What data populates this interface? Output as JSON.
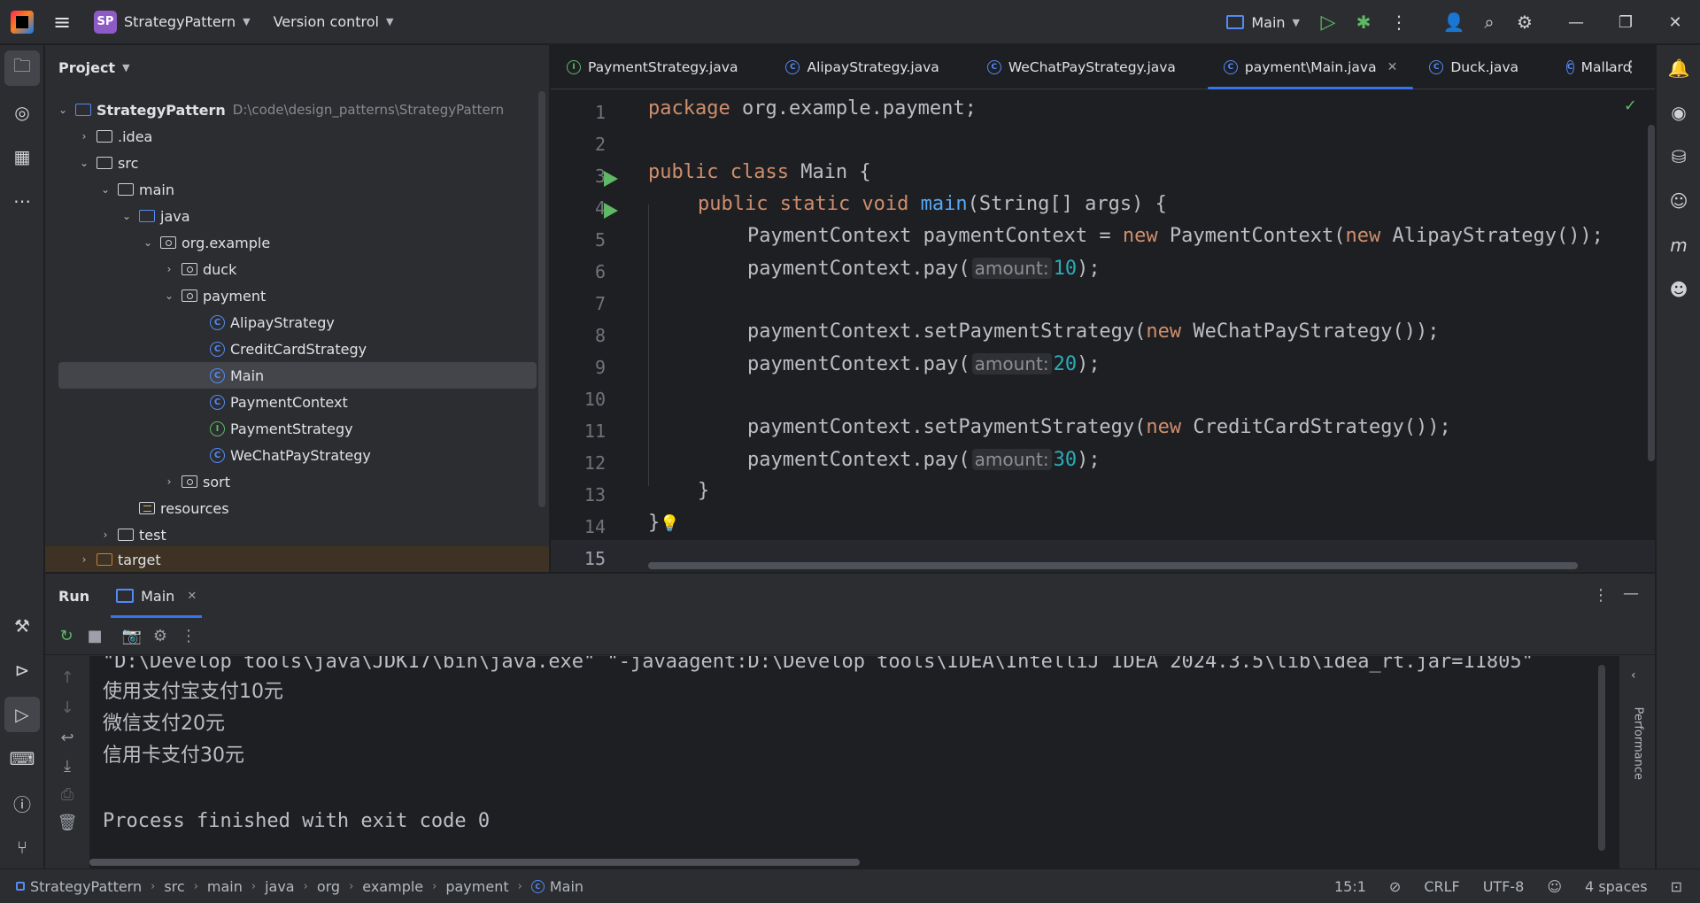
{
  "titlebar": {
    "project_badge": "SP",
    "project_name": "StrategyPattern",
    "vcs": "Version control",
    "run_config": "Main"
  },
  "project_panel": {
    "title": "Project",
    "root_name": "StrategyPattern",
    "root_path": "D:\\code\\design_patterns\\StrategyPattern",
    "items": [
      ".idea",
      "src",
      "main",
      "java",
      "org.example",
      "duck",
      "payment",
      "AlipayStrategy",
      "CreditCardStrategy",
      "Main",
      "PaymentContext",
      "PaymentStrategy",
      "WeChatPayStrategy",
      "sort",
      "resources",
      "test",
      "target"
    ]
  },
  "editor": {
    "tabs": [
      "PaymentStrategy.java",
      "AlipayStrategy.java",
      "WeChatPayStrategy.java",
      "payment\\Main.java",
      "Duck.java",
      "Mallard"
    ],
    "line_numbers": [
      "1",
      "2",
      "3",
      "4",
      "5",
      "6",
      "7",
      "8",
      "9",
      "10",
      "11",
      "12",
      "13",
      "14",
      "15"
    ],
    "code": {
      "l1_kw": "package",
      "l1_rest": " org.example.payment;",
      "l3_kw": "public class",
      "l3_rest": " Main {",
      "l4_kw": "public static void",
      "l4_fn": "main",
      "l4_rest": "(String[] args) {",
      "l5_a": "PaymentContext paymentContext = ",
      "l5_kw1": "new",
      "l5_b": " PaymentContext(",
      "l5_kw2": "new",
      "l5_c": " AlipayStrategy());",
      "pay_call": "paymentContext.pay(",
      "hint_label": "amount:",
      "v10": "10",
      "v20": "20",
      "v30": "30",
      "call_end": ");",
      "set_call": "paymentContext.setPaymentStrategy(",
      "kw_new": "new",
      "l8_rest": " WeChatPayStrategy());",
      "l11_rest": " CreditCardStrategy());",
      "l13": "}",
      "l14": "}"
    }
  },
  "run_panel": {
    "title": "Run",
    "tab": "Main",
    "cmd_line": "\"D:\\Develop tools\\java\\JDK17\\bin\\java.exe\" \"-javaagent:D:\\Develop tools\\IDEA\\IntelliJ IDEA 2024.3.5\\lib\\idea_rt.jar=11805\"",
    "out1": "使用支付宝支付10元",
    "out2": "微信支付20元",
    "out3": "信用卡支付30元",
    "exit": "Process finished with exit code 0",
    "side_label": "Performance"
  },
  "statusbar": {
    "breadcrumbs": [
      "StrategyPattern",
      "src",
      "main",
      "java",
      "org",
      "example",
      "payment",
      "Main"
    ],
    "position": "15:1",
    "line_sep": "CRLF",
    "encoding": "UTF-8",
    "indent": "4 spaces"
  }
}
